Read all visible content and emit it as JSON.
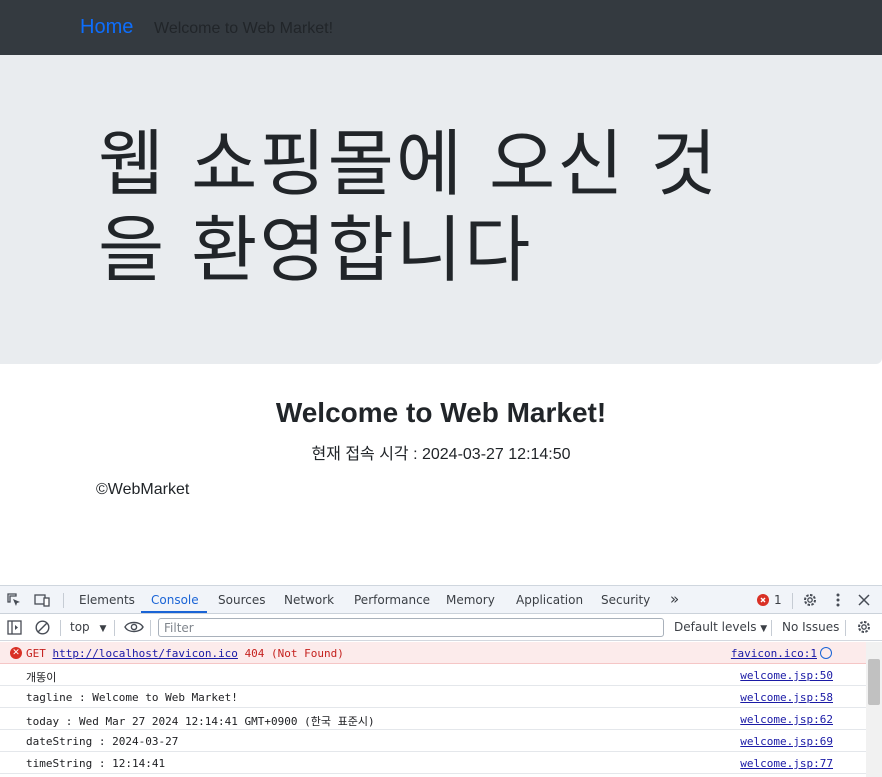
{
  "navbar": {
    "home_label": "Home",
    "greeting": "Welcome to Web Market!"
  },
  "jumbotron": {
    "title": "웹 쇼핑몰에 오신 것을 환영합니다"
  },
  "main": {
    "welcome": "Welcome to Web Market!",
    "time_label": "현재 접속 시각 : 2024-03-27 12:14:50"
  },
  "footer": {
    "copyright": "©WebMarket"
  },
  "devtools": {
    "tabs": [
      "Elements",
      "Console",
      "Sources",
      "Network",
      "Performance",
      "Memory",
      "Application",
      "Security"
    ],
    "active_tab": "Console",
    "more_tabs": "»",
    "error_count": "1",
    "context": "top",
    "filter_placeholder": "Filter",
    "levels_label": "Default levels",
    "issues_label": "No Issues",
    "error_row": {
      "method": "GET",
      "url": "http://localhost/favicon.ico",
      "status": "404 (Not Found)",
      "source": "favicon.ico:1"
    },
    "logs": [
      {
        "message": "개똥이",
        "source": "welcome.jsp:50"
      },
      {
        "message": "tagline : Welcome to Web Market!",
        "source": "welcome.jsp:58"
      },
      {
        "message": "today : Wed Mar 27 2024 12:14:41 GMT+0900 (한국 표준시)",
        "source": "welcome.jsp:62"
      },
      {
        "message": "dateString : 2024-03-27",
        "source": "welcome.jsp:69"
      },
      {
        "message": "timeString : 12:14:41",
        "source": "welcome.jsp:77"
      }
    ],
    "colors": {
      "active_tab": "#1a64d6",
      "error": "#d93025"
    }
  }
}
